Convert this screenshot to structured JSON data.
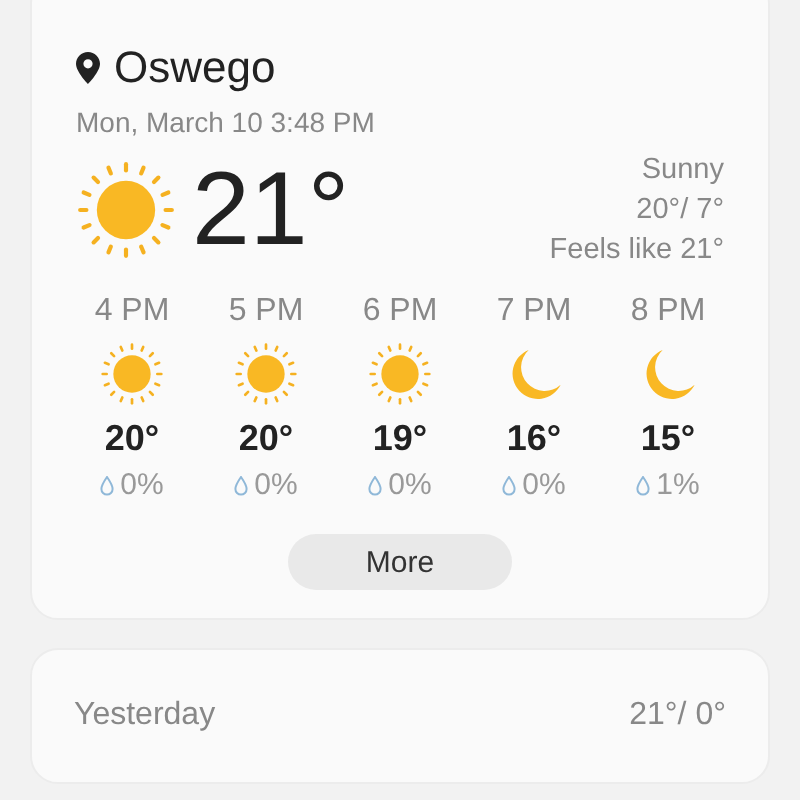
{
  "current": {
    "location": "Oswego",
    "datetime": "Mon, March 10 3:48 PM",
    "temperature": "21°",
    "kind": "sun",
    "condition": "Sunny",
    "high_low": "20°/ 7°",
    "feels_like": "Feels like 21°"
  },
  "hourly": [
    {
      "time": "4 PM",
      "kind": "sun",
      "temperature": "20°",
      "precipitation": "0%"
    },
    {
      "time": "5 PM",
      "kind": "sun",
      "temperature": "20°",
      "precipitation": "0%"
    },
    {
      "time": "6 PM",
      "kind": "sun",
      "temperature": "19°",
      "precipitation": "0%"
    },
    {
      "time": "7 PM",
      "kind": "moon",
      "temperature": "16°",
      "precipitation": "0%"
    },
    {
      "time": "8 PM",
      "kind": "moon",
      "temperature": "15°",
      "precipitation": "1%"
    }
  ],
  "more_button": "More",
  "yesterday": {
    "label": "Yesterday",
    "high_low": "21°/ 0°"
  }
}
